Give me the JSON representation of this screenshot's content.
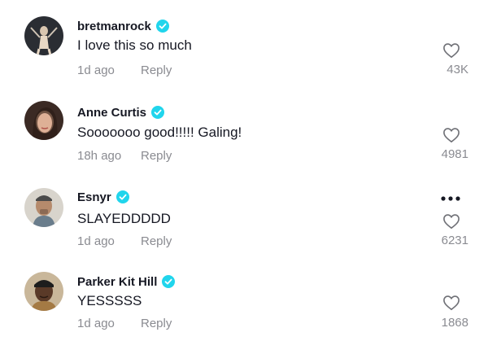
{
  "comments": [
    {
      "username": "bretmanrock",
      "verified": true,
      "text": "I love this so much",
      "time": "1d ago",
      "reply_label": "Reply",
      "likes": "43K"
    },
    {
      "username": "Anne Curtis",
      "verified": true,
      "text": "Sooooooo good!!!!! Galing!",
      "time": "18h ago",
      "reply_label": "Reply",
      "likes": "4981"
    },
    {
      "username": "Esnyr",
      "verified": true,
      "text": "SLAYEDDDDD",
      "time": "1d ago",
      "reply_label": "Reply",
      "likes": "6231",
      "has_more_menu": true
    },
    {
      "username": "Parker Kit Hill",
      "verified": true,
      "text": "YESSSSS",
      "time": "1d ago",
      "reply_label": "Reply",
      "likes": "1868"
    }
  ],
  "colors": {
    "verified_badge": "#20d5ec",
    "secondary_text": "#8a8b91",
    "primary_text": "#161823"
  },
  "icons": {
    "verified": "verified-badge-icon",
    "like": "heart-outline-icon",
    "more": "more-horizontal-icon"
  }
}
